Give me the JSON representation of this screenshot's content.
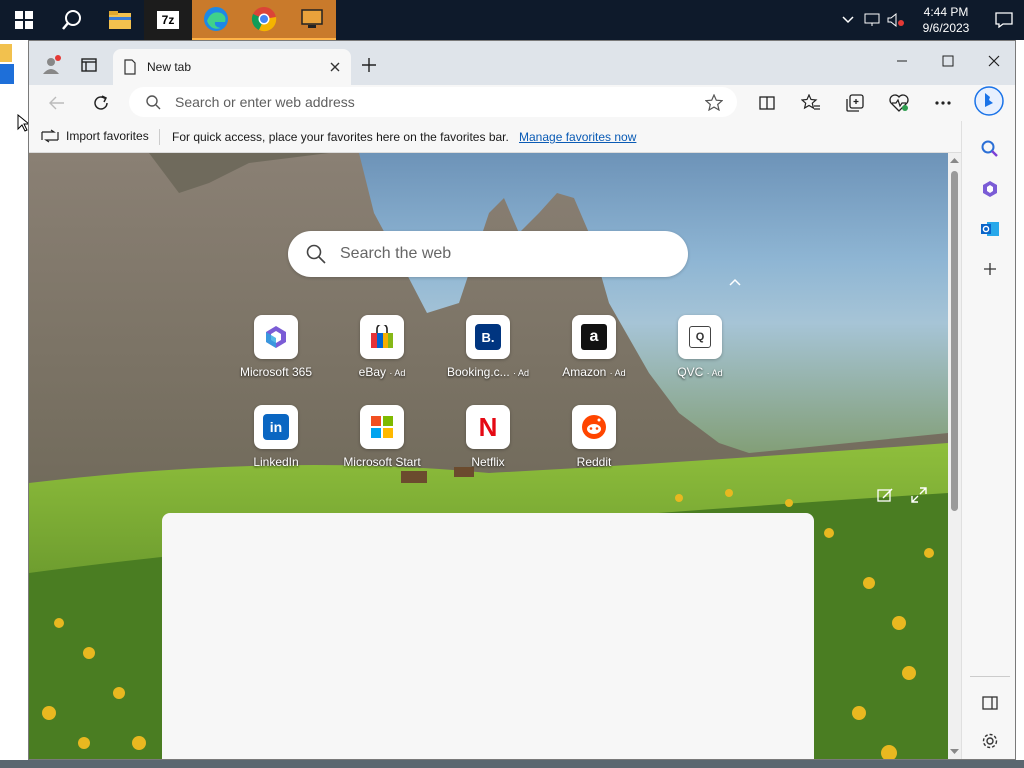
{
  "taskbar": {
    "pinned": [
      {
        "name": "start",
        "icon": "windows-logo-icon"
      },
      {
        "name": "search",
        "icon": "search-icon"
      },
      {
        "name": "file-explorer",
        "icon": "folder-icon"
      },
      {
        "name": "7zip",
        "icon": "7zip-icon",
        "label": "7z"
      },
      {
        "name": "edge",
        "icon": "edge-icon"
      },
      {
        "name": "chrome",
        "icon": "chrome-icon"
      },
      {
        "name": "app",
        "icon": "app-icon"
      }
    ],
    "clock": {
      "time": "4:44 PM",
      "date": "9/6/2023"
    }
  },
  "browser": {
    "tab": {
      "label": "New tab"
    },
    "address": {
      "placeholder": "Search or enter web address"
    },
    "favorites_bar": {
      "import_label": "Import favorites",
      "message": "For quick access, place your favorites here on the favorites bar.",
      "manage_link": "Manage favorites now"
    }
  },
  "new_tab": {
    "search_placeholder": "Search the web",
    "tiles_row1": [
      {
        "label": "Microsoft 365",
        "ad": "",
        "icon": "microsoft365-icon"
      },
      {
        "label": "eBay",
        "ad": "· Ad",
        "icon": "ebay-icon"
      },
      {
        "label": "Booking.c...",
        "ad": "· Ad",
        "icon": "booking-icon",
        "glyph": "B."
      },
      {
        "label": "Amazon",
        "ad": "· Ad",
        "icon": "amazon-icon",
        "glyph": "a"
      },
      {
        "label": "QVC",
        "ad": "· Ad",
        "icon": "qvc-icon",
        "glyph": "Q"
      }
    ],
    "tiles_row2": [
      {
        "label": "LinkedIn",
        "icon": "linkedin-icon",
        "glyph": "in"
      },
      {
        "label": "Microsoft Start",
        "icon": "microsoft-start-icon"
      },
      {
        "label": "Netflix",
        "icon": "netflix-icon",
        "glyph": "N"
      },
      {
        "label": "Reddit",
        "icon": "reddit-icon"
      }
    ]
  },
  "colors": {
    "taskbar": "#0e1a2b",
    "active_app": "#c97a2b",
    "link": "#0a5bb5",
    "bing": "#1a73e8"
  }
}
